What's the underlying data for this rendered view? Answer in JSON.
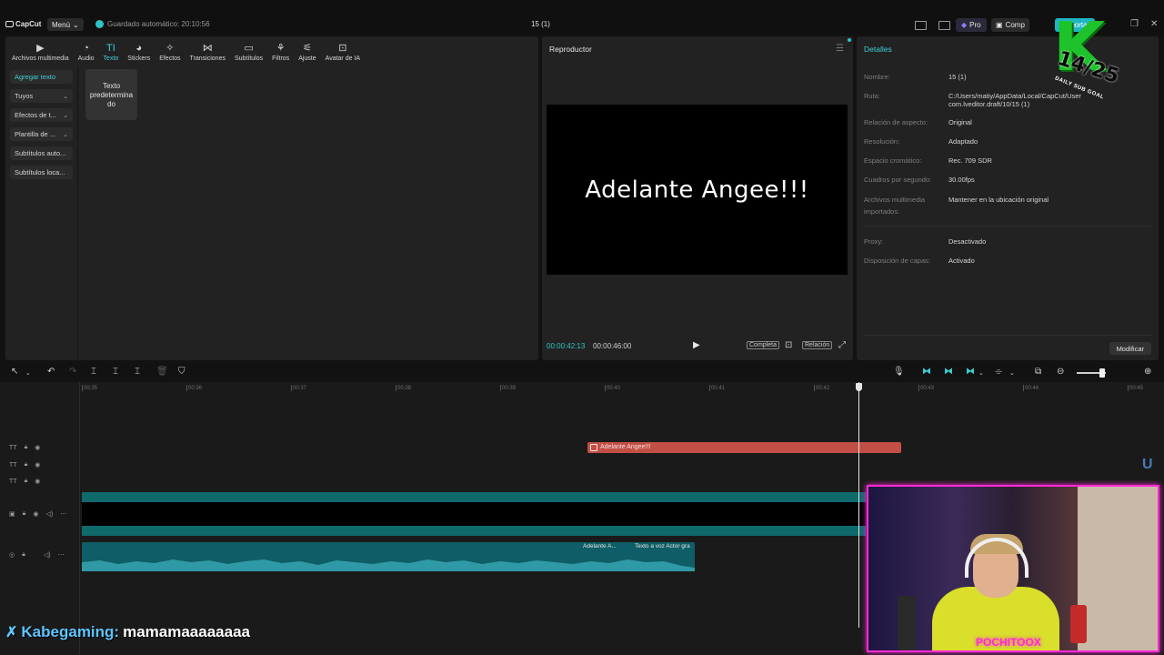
{
  "titlebar": {
    "logo_text": "CapCut",
    "menu_label": "Menú",
    "autosave": "Guardado automático: 20:10:56",
    "project_title": "15 (1)",
    "pro_label": "Pro",
    "share_label": "Comp",
    "export_label": "Exporta"
  },
  "media_tabs": [
    {
      "label": "Archivos multimedia",
      "icon": "media-icon"
    },
    {
      "label": "Audio",
      "icon": "audio-icon"
    },
    {
      "label": "Texto",
      "icon": "text-icon",
      "active": true
    },
    {
      "label": "Stickers",
      "icon": "sticker-icon"
    },
    {
      "label": "Efectos",
      "icon": "effects-icon"
    },
    {
      "label": "Transiciones",
      "icon": "transitions-icon"
    },
    {
      "label": "Subtítulos",
      "icon": "subtitles-icon"
    },
    {
      "label": "Filtros",
      "icon": "filters-icon"
    },
    {
      "label": "Ajuste",
      "icon": "adjust-icon"
    },
    {
      "label": "Avatar de IA",
      "icon": "ai-avatar-icon"
    }
  ],
  "left_nav": [
    {
      "label": "Agregar texto",
      "active": true
    },
    {
      "label": "Tuyos",
      "chevron": true
    },
    {
      "label": "Efectos de t...",
      "chevron": true
    },
    {
      "label": "Plantilla de ...",
      "chevron": true
    },
    {
      "label": "Subtítulos auto..."
    },
    {
      "label": "Subtítulos loca..."
    }
  ],
  "text_card": "Texto predetermina do",
  "player": {
    "title": "Reproductor",
    "preview_text": "Adelante Angee!!!",
    "current_time": "00:00:42:13",
    "total_time": "00:00:46:00",
    "full_label": "Completa",
    "ratio_label": "Relación"
  },
  "details": {
    "title": "Detalles",
    "rows": [
      {
        "key": "Nombre:",
        "value": "15 (1)"
      },
      {
        "key": "Ruta:",
        "value": "C:/Users/matiy/AppData/Local/CapCut/User com.lveditor.draft/10/15 (1)"
      },
      {
        "key": "Relación de aspecto:",
        "value": "Original"
      },
      {
        "key": "Resolución:",
        "value": "Adaptado"
      },
      {
        "key": "Espacio cromático:",
        "value": "Rec. 709 SDR"
      },
      {
        "key": "Cuadros por segundo:",
        "value": "30.00fps"
      },
      {
        "key": "Archivos multimedia importados:",
        "value": "Mantener en la ubicación original"
      },
      {
        "key": "Proxy:",
        "value": "Desactivado"
      },
      {
        "key": "Disposición de capas:",
        "value": "Activado"
      }
    ],
    "modify_label": "Modificar"
  },
  "timeline": {
    "ruler_ticks": [
      "00:35",
      "00:36",
      "00:37",
      "00:38",
      "00:39",
      "00:40",
      "00:41",
      "00:42",
      "00:43",
      "00:44",
      "00:45"
    ],
    "text_clip": "Adelante Angee!!!",
    "audio_clip_1": "Adelante A...",
    "audio_clip_2": "Texto a voz Actor gra",
    "stray_label": "U"
  },
  "overlays": {
    "goal_count": "14/25",
    "goal_sub": "DAILY SUB GOAL",
    "cam_logo": "POCHITOOX",
    "chat_user": "Kabegaming:",
    "chat_message": "mamamaaaaaaaa"
  },
  "colors": {
    "accent": "#3fd0d6",
    "text_clip": "#c24f46",
    "export": "#1fb6c1",
    "cam_border": "#ff2bd6"
  }
}
